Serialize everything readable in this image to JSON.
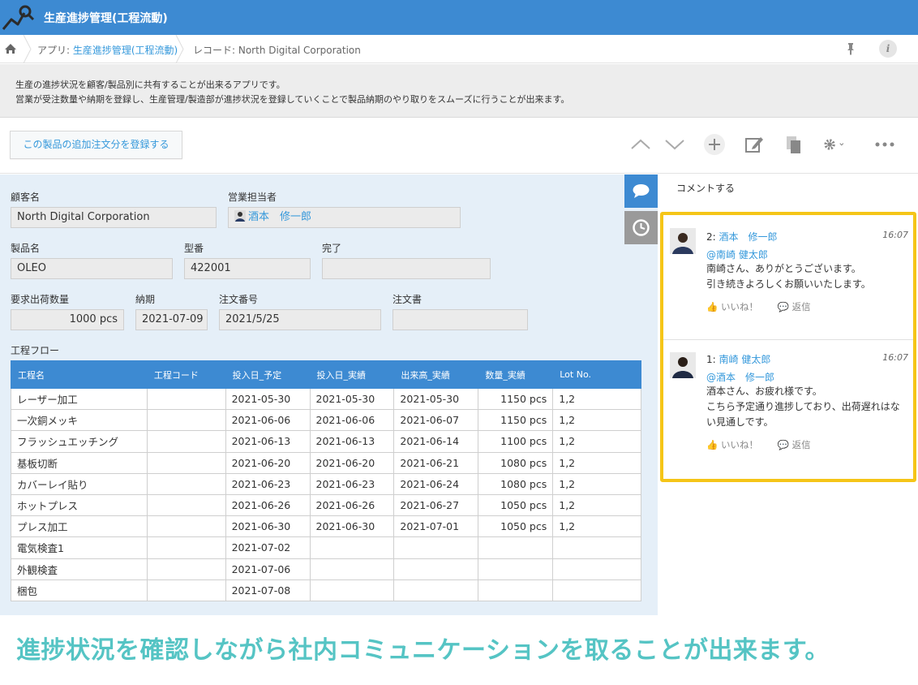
{
  "app": {
    "title": "生産進捗管理(工程流動)"
  },
  "breadcrumb": {
    "app_prefix": "アプリ: ",
    "app_name": "生産進捗管理(工程流動)",
    "record": "レコード: North Digital Corporation"
  },
  "description": {
    "line1": "生産の進捗状況を顧客/製品別に共有することが出来るアプリです。",
    "line2": "営業が受注数量や納期を登録し、生産管理/製造部が進捗状況を登録していくことで製品納期のやり取りをスムーズに行うことが出来ます。"
  },
  "toolbar": {
    "action_label": "この製品の追加注文分を登録する"
  },
  "fields": {
    "customer_label": "顧客名",
    "customer_value": "North Digital Corporation",
    "sales_label": "営業担当者",
    "sales_value": "酒本　修一郎",
    "product_label": "製品名",
    "product_value": "OLEO",
    "model_label": "型番",
    "model_value": "422001",
    "done_label": "完了",
    "done_value": "",
    "qty_label": "要求出荷数量",
    "qty_value": "1000 pcs",
    "due_label": "納期",
    "due_value": "2021-07-09",
    "order_no_label": "注文番号",
    "order_no_value": "2021/5/25",
    "order_doc_label": "注文書",
    "order_doc_value": "",
    "flow_label": "工程フロー"
  },
  "flow_table": {
    "headers": [
      "工程名",
      "工程コード",
      "投入日_予定",
      "投入日_実績",
      "出来高_実績",
      "数量_実績",
      "Lot No."
    ],
    "rows": [
      [
        "レーザー加工",
        "",
        "2021-05-30",
        "2021-05-30",
        "2021-05-30",
        "1150 pcs",
        "1,2"
      ],
      [
        "一次銅メッキ",
        "",
        "2021-06-06",
        "2021-06-06",
        "2021-06-07",
        "1150 pcs",
        "1,2"
      ],
      [
        "フラッシュエッチング",
        "",
        "2021-06-13",
        "2021-06-13",
        "2021-06-14",
        "1100 pcs",
        "1,2"
      ],
      [
        "基板切断",
        "",
        "2021-06-20",
        "2021-06-20",
        "2021-06-21",
        "1080 pcs",
        "1,2"
      ],
      [
        "カバーレイ貼り",
        "",
        "2021-06-23",
        "2021-06-23",
        "2021-06-24",
        "1080 pcs",
        "1,2"
      ],
      [
        "ホットプレス",
        "",
        "2021-06-26",
        "2021-06-26",
        "2021-06-27",
        "1050 pcs",
        "1,2"
      ],
      [
        "プレス加工",
        "",
        "2021-06-30",
        "2021-06-30",
        "2021-07-01",
        "1050 pcs",
        "1,2"
      ],
      [
        "電気検査1",
        "",
        "2021-07-02",
        "",
        "",
        "",
        ""
      ],
      [
        "外観検査",
        "",
        "2021-07-06",
        "",
        "",
        "",
        ""
      ],
      [
        "梱包",
        "",
        "2021-07-08",
        "",
        "",
        "",
        ""
      ]
    ]
  },
  "comments": {
    "post_label": "コメントする",
    "items": [
      {
        "number": "2: ",
        "author": "酒本　修一郎",
        "time": "16:07",
        "mention": "@南崎 健太郎",
        "lines": [
          "南崎さん、ありがとうございます。",
          "引き続きよろしくお願いいたします。"
        ],
        "like": "いいね！",
        "reply": "返信"
      },
      {
        "number": "1: ",
        "author": "南崎 健太郎",
        "time": "16:07",
        "mention": "@酒本　修一郎",
        "lines": [
          "酒本さん、お疲れ様です。",
          "こちら予定通り進捗しており、出荷遅れはな",
          "い見通しです。"
        ],
        "like": "いいね！",
        "reply": "返信"
      }
    ]
  },
  "caption": "進捗状況を確認しながら社内コミュニケーションを取ることが出来ます。",
  "colors": {
    "header": "#3d8ad2",
    "link": "#3498db",
    "highlight": "#f5c518",
    "caption": "#55c4c4"
  }
}
